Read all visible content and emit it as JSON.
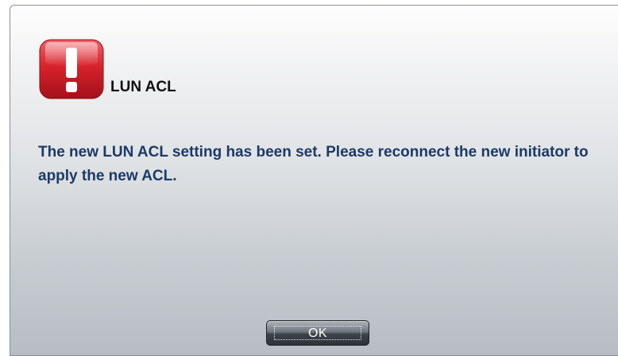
{
  "dialog": {
    "icon": "exclamation-alert-icon",
    "title": "LUN ACL",
    "message": "The new LUN ACL setting has been set. Please reconnect the new initiator to apply the new ACL.",
    "ok_label": "OK"
  },
  "colors": {
    "icon_red": "#d8222b",
    "message_text": "#1c3a66",
    "title_text": "#111111",
    "button_dark": "#2d3338"
  }
}
